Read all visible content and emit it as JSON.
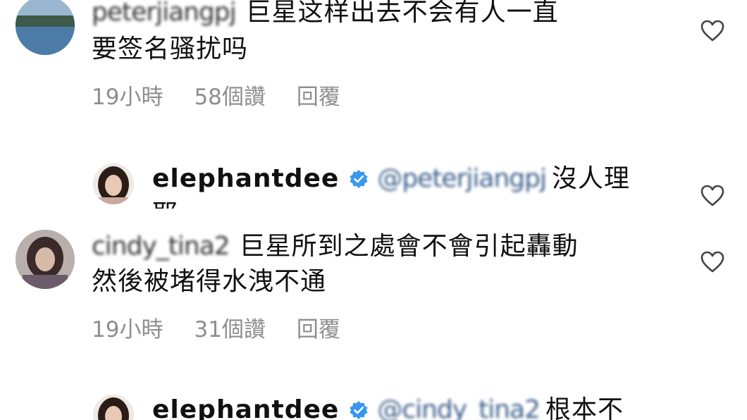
{
  "comments": [
    {
      "username": "peterjiangpj",
      "text_line1": "巨星这样出去不会有人一直",
      "text_line2": "要签名骚扰吗",
      "time": "19小時",
      "likes": "58個讚",
      "reply": "回覆"
    },
    {
      "username": "elephantdee",
      "mention": "@peterjiangpj",
      "text_line1": "沒人理",
      "text_line2": "耶"
    },
    {
      "username": "cindy_tina2",
      "text_line1": "巨星所到之處會不會引起轟動",
      "text_line2": "然後被堵得水洩不通",
      "time": "19小時",
      "likes": "31個讚",
      "reply": "回覆"
    },
    {
      "username": "elephantdee",
      "mention": "@cindy_tina2",
      "text_line1": "根本不"
    }
  ],
  "icons": {
    "heart": "heart-outline-icon",
    "verified": "verified-badge-icon"
  },
  "colors": {
    "meta_gray": "#8e8e8e",
    "verified_blue": "#3897f0"
  }
}
